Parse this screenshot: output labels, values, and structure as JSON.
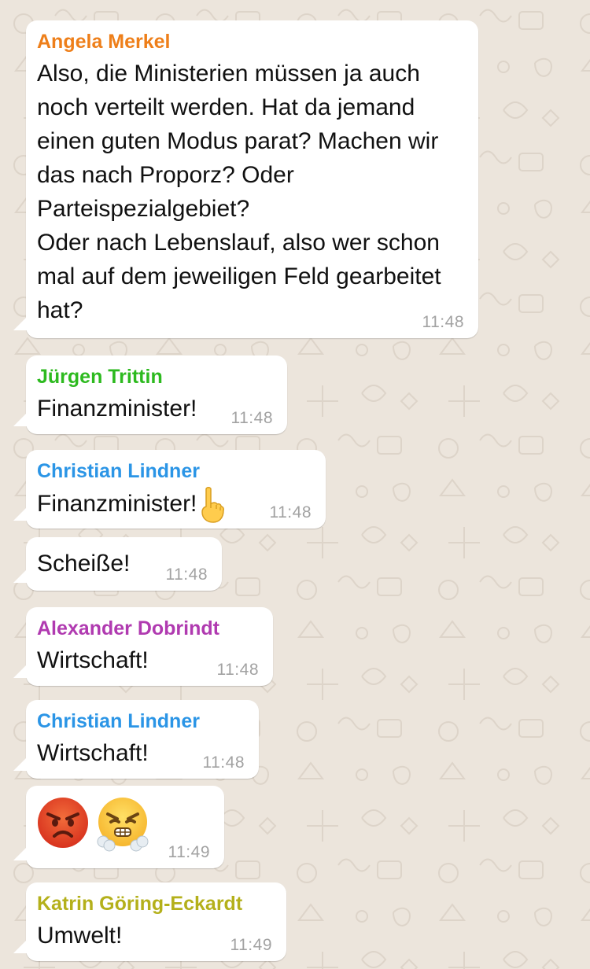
{
  "chat": {
    "messages": [
      {
        "sender": "Angela Merkel",
        "sender_color": "#ee7f1a",
        "text": "Also, die Ministerien müssen ja auch noch verteilt werden. Hat da jemand einen guten Modus parat? Machen wir das nach Proporz? Oder Parteispezialgebiet?\nOder nach Lebenslauf, also wer schon mal auf dem jeweiligen Feld gearbeitet hat?",
        "time": "11:48"
      },
      {
        "sender": "Jürgen Trittin",
        "sender_color": "#2dba1f",
        "text": "Finanzminister!",
        "time": "11:48"
      },
      {
        "sender": "Christian Lindner",
        "sender_color": "#2b95e6",
        "text": "Finanzminister!",
        "emoji": "index-pointing-up-icon",
        "time": "11:48"
      },
      {
        "text": "Scheiße!",
        "time": "11:48"
      },
      {
        "sender": "Alexander Dobrindt",
        "sender_color": "#b03ab0",
        "text": "Wirtschaft!",
        "time": "11:48"
      },
      {
        "sender": "Christian Lindner",
        "sender_color": "#2b95e6",
        "text": "Wirtschaft!",
        "time": "11:48"
      },
      {
        "emojis": [
          "pouting-face-icon",
          "face-with-steam-icon"
        ],
        "time": "11:49"
      },
      {
        "sender": "Katrin Göring-Eckardt",
        "sender_color": "#b4b01b",
        "text": "Umwelt!",
        "time": "11:49"
      }
    ]
  }
}
